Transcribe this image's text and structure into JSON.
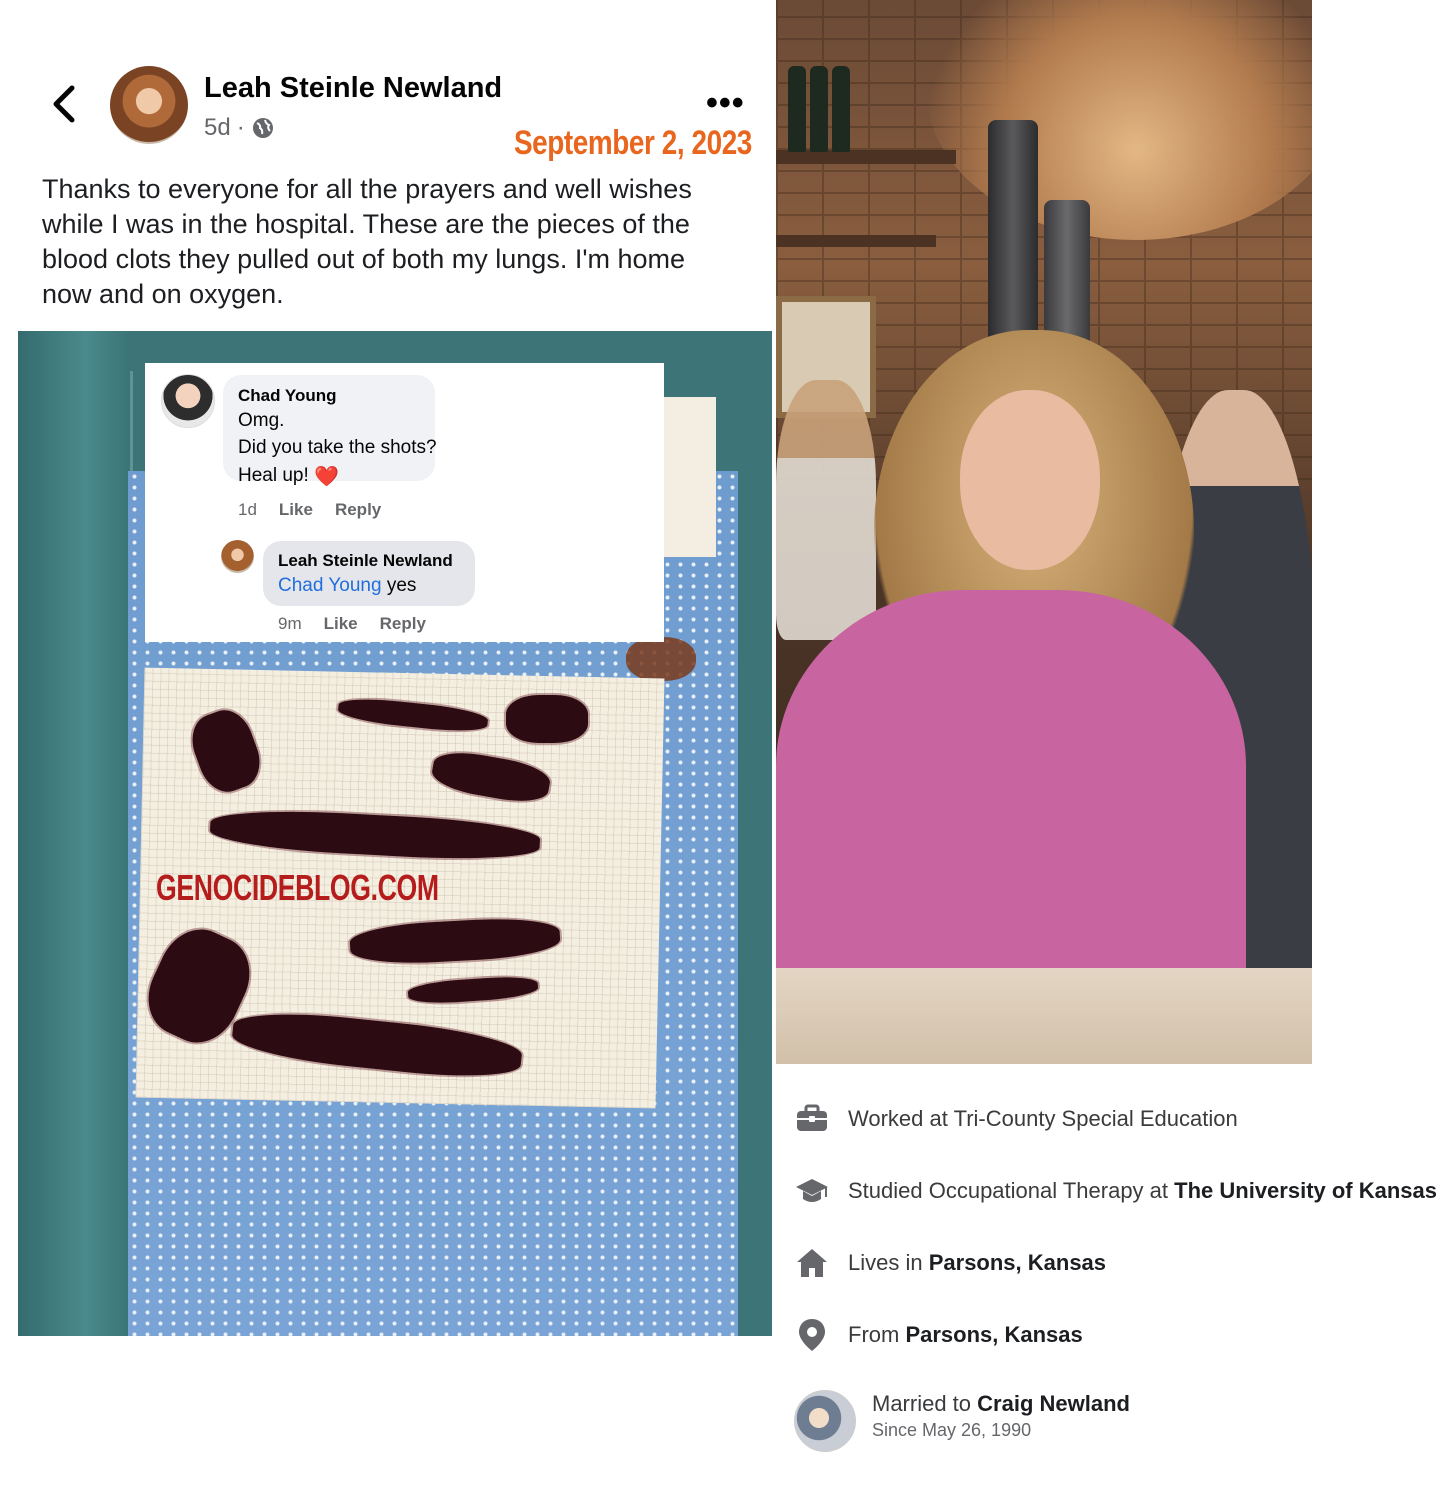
{
  "post": {
    "author_name": "Leah Steinle Newland",
    "time": "5d",
    "separator": "·",
    "privacy_icon": "globe-icon",
    "more_label": "•••",
    "date_stamp": "September 2, 2023",
    "text": "Thanks to everyone for all the prayers and well wishes while I was in the hospital. These are the pieces of the blood clots they pulled out of both my lungs. I'm home now and on oxygen.",
    "watermark": "GENOCIDEBLOG.COM"
  },
  "comments": [
    {
      "author": "Chad Young",
      "lines": [
        "Omg.",
        "Did you take the shots?",
        "Heal up!"
      ],
      "emoji": "❤️",
      "time": "1d",
      "like_label": "Like",
      "reply_label": "Reply"
    },
    {
      "author": "Leah Steinle Newland",
      "mention": "Chad Young",
      "text": "yes",
      "time": "9m",
      "like_label": "Like",
      "reply_label": "Reply"
    }
  ],
  "about": {
    "work": {
      "prefix": "Worked at Tri-County Special Education",
      "icon": "briefcase-icon"
    },
    "education": {
      "prefix": "Studied Occupational Therapy at",
      "place": "The University of Kansas",
      "icon": "graduation-cap-icon"
    },
    "lives": {
      "prefix": "Lives in",
      "place": "Parsons, Kansas",
      "icon": "home-icon"
    },
    "from": {
      "prefix": "From",
      "place": "Parsons, Kansas",
      "icon": "location-pin-icon"
    },
    "married": {
      "prefix": "Married to",
      "name": "Craig Newland",
      "since": "Since May 26, 1990"
    }
  },
  "colors": {
    "date_stamp": "#e8661e",
    "mention": "#216fdb",
    "watermark": "#b51c1c",
    "muted_text": "#65676b"
  }
}
